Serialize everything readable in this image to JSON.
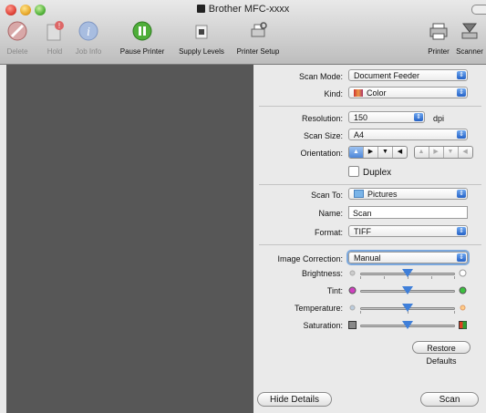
{
  "window": {
    "title": "Brother MFC-xxxx"
  },
  "toolbar": {
    "delete": "Delete",
    "hold": "Hold",
    "job_info": "Job Info",
    "pause_printer": "Pause Printer",
    "supply_levels": "Supply Levels",
    "printer_setup": "Printer Setup",
    "printer": "Printer",
    "scanner": "Scanner"
  },
  "scan": {
    "mode_label": "Scan Mode:",
    "mode_value": "Document Feeder",
    "kind_label": "Kind:",
    "kind_value": "Color",
    "resolution_label": "Resolution:",
    "resolution_value": "150",
    "resolution_unit": "dpi",
    "size_label": "Scan Size:",
    "size_value": "A4",
    "orientation_label": "Orientation:",
    "duplex_label": "Duplex",
    "scan_to_label": "Scan To:",
    "scan_to_value": "Pictures",
    "name_label": "Name:",
    "name_value": "Scan",
    "format_label": "Format:",
    "format_value": "TIFF",
    "image_correction_label": "Image Correction:",
    "image_correction_value": "Manual",
    "brightness_label": "Brightness:",
    "tint_label": "Tint:",
    "temperature_label": "Temperature:",
    "saturation_label": "Saturation:",
    "restore_defaults": "Restore Defaults",
    "hide_details": "Hide Details",
    "scan_button": "Scan"
  },
  "sliders": {
    "brightness": 0.5,
    "tint": 0.5,
    "temperature": 0.5,
    "saturation": 0.5
  },
  "colors": {
    "preview_bg": "#575757",
    "accent": "#3f7fd9"
  }
}
